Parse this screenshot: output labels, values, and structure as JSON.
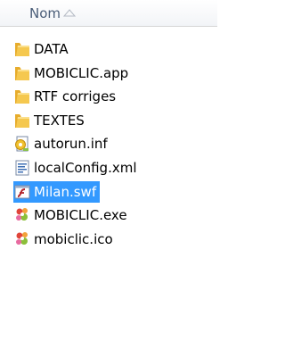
{
  "header": {
    "column_label": "Nom",
    "sort_direction": "ascending"
  },
  "files": [
    {
      "name": "DATA",
      "icon": "folder-icon",
      "selected": false
    },
    {
      "name": "MOBICLIC.app",
      "icon": "folder-icon",
      "selected": false
    },
    {
      "name": "RTF corriges",
      "icon": "folder-icon",
      "selected": false
    },
    {
      "name": "TEXTES",
      "icon": "folder-icon",
      "selected": false
    },
    {
      "name": "autorun.inf",
      "icon": "autorun-file-icon",
      "selected": false
    },
    {
      "name": "localConfig.xml",
      "icon": "xml-file-icon",
      "selected": false
    },
    {
      "name": "Milan.swf",
      "icon": "flash-file-icon",
      "selected": true
    },
    {
      "name": "MOBICLIC.exe",
      "icon": "app-exe-icon",
      "selected": false
    },
    {
      "name": "mobiclic.ico",
      "icon": "ico-file-icon",
      "selected": false
    }
  ],
  "colors": {
    "selection": "#3399ff",
    "folder": "#f1c34b",
    "header_text": "#4a5d78"
  }
}
